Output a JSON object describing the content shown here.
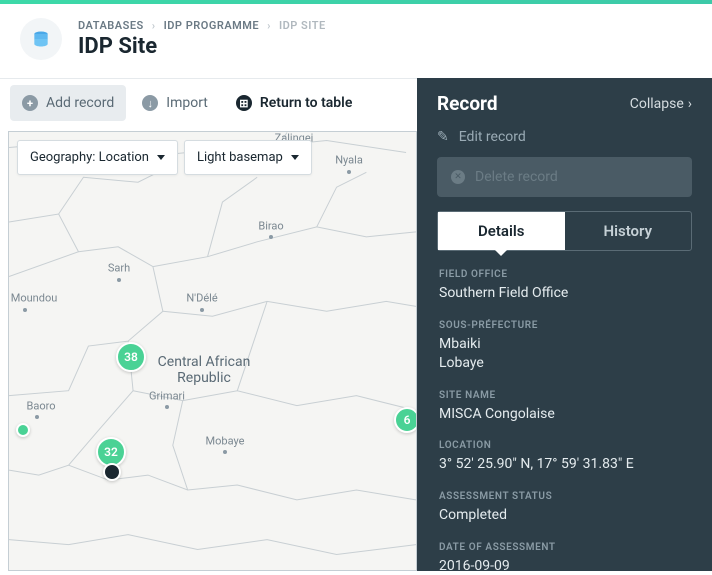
{
  "breadcrumb": {
    "l1": "DATABASES",
    "l2": "IDP PROGRAMME",
    "l3": "IDP SITE"
  },
  "title": "IDP Site",
  "toolbar": {
    "add": "Add record",
    "import": "Import",
    "return": "Return to table"
  },
  "map": {
    "geo": "Geography: Location",
    "basemap": "Light basemap",
    "cities": {
      "zalingei": "Zalingei",
      "nyala": "Nyala",
      "birao": "Birao",
      "sarh": "Sarh",
      "ndele": "N'Délé",
      "moundou": "Moundou",
      "car": "Central African\nRepublic",
      "grimari": "Grimari",
      "baoro": "Baoro",
      "mobaye": "Mobaye"
    },
    "markers": {
      "m38": "38",
      "m32": "32",
      "m6": "6"
    }
  },
  "panel": {
    "title": "Record",
    "collapse": "Collapse",
    "edit": "Edit record",
    "delete": "Delete record",
    "tabs": {
      "details": "Details",
      "history": "History"
    },
    "fields": {
      "fo_l": "FIELD OFFICE",
      "fo_v": "Southern Field Office",
      "sp_l": "SOUS-PRÉFECTURE",
      "sp_v": "Mbaiki\nLobaye",
      "sn_l": "SITE NAME",
      "sn_v": "MISCA Congolaise",
      "loc_l": "LOCATION",
      "loc_v": "3° 52' 25.90\" N, 17° 59' 31.83\" E",
      "as_l": "ASSESSMENT STATUS",
      "as_v": "Completed",
      "da_l": "DATE OF ASSESSMENT",
      "da_v": "2016-09-09"
    }
  }
}
